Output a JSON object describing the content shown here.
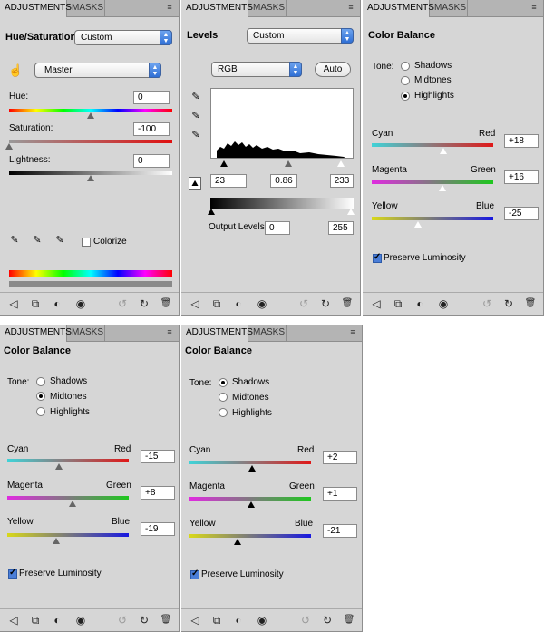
{
  "tabs": {
    "adjustments": "ADJUSTMENTS",
    "masks": "MASKS"
  },
  "menu_icon": "≡",
  "hue_sat": {
    "title": "Hue/Saturation",
    "preset": "Custom",
    "channel": "Master",
    "hue_label": "Hue:",
    "hue_value": "0",
    "sat_label": "Saturation:",
    "sat_value": "-100",
    "light_label": "Lightness:",
    "light_value": "0",
    "colorize_label": "Colorize"
  },
  "levels": {
    "title": "Levels",
    "preset": "Custom",
    "channel": "RGB",
    "auto_label": "Auto",
    "input_black": "23",
    "input_gamma": "0.86",
    "input_white": "233",
    "output_label": "Output Levels:",
    "output_black": "0",
    "output_white": "255"
  },
  "cb_highlights": {
    "title": "Color Balance",
    "tone_label": "Tone:",
    "shadows": "Shadows",
    "midtones": "Midtones",
    "highlights": "Highlights",
    "cyan": "Cyan",
    "red": "Red",
    "magenta": "Magenta",
    "green": "Green",
    "yellow": "Yellow",
    "blue": "Blue",
    "cyan_red": "+18",
    "magenta_green": "+16",
    "yellow_blue": "-25",
    "preserve": "Preserve Luminosity"
  },
  "cb_midtones": {
    "title": "Color Balance",
    "tone_label": "Tone:",
    "shadows": "Shadows",
    "midtones": "Midtones",
    "highlights": "Highlights",
    "cyan": "Cyan",
    "red": "Red",
    "magenta": "Magenta",
    "green": "Green",
    "yellow": "Yellow",
    "blue": "Blue",
    "cyan_red": "-15",
    "magenta_green": "+8",
    "yellow_blue": "-19",
    "preserve": "Preserve Luminosity"
  },
  "cb_shadows": {
    "title": "Color Balance",
    "tone_label": "Tone:",
    "shadows": "Shadows",
    "midtones": "Midtones",
    "highlights": "Highlights",
    "cyan": "Cyan",
    "red": "Red",
    "magenta": "Magenta",
    "green": "Green",
    "yellow": "Yellow",
    "blue": "Blue",
    "cyan_red": "+2",
    "magenta_green": "+1",
    "yellow_blue": "-21",
    "preserve": "Preserve Luminosity"
  },
  "footer_icons": {
    "back": "◁",
    "expand": "⧉",
    "clip": "◐",
    "eye": "◉",
    "prev": "↺",
    "reset": "↻",
    "trash": "🗑"
  }
}
